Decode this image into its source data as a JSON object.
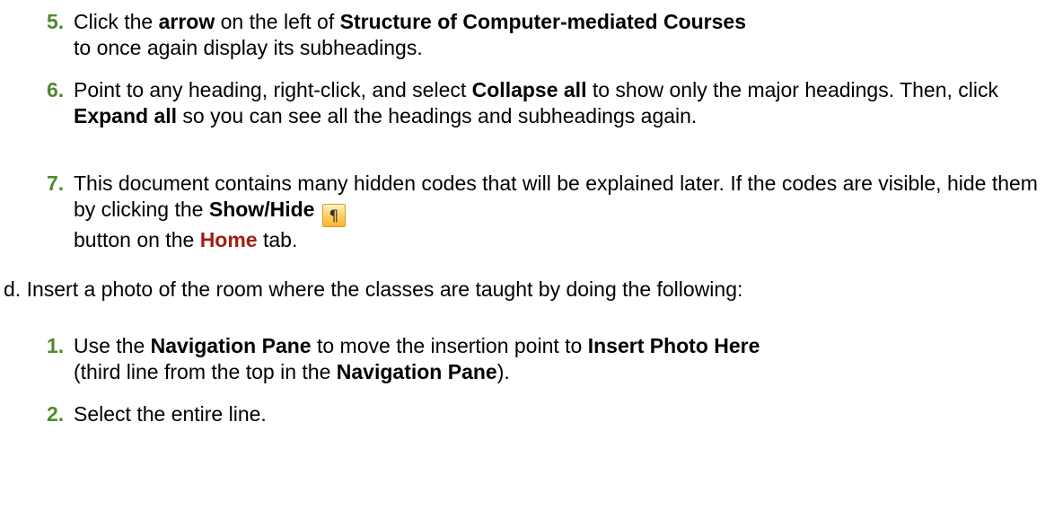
{
  "steps_c": [
    {
      "num": "5.",
      "parts": [
        "Click the ",
        "arrow",
        " on the left of ",
        "Structure of Computer-mediated Courses",
        " to once again display its subheadings."
      ]
    },
    {
      "num": "6.",
      "parts": [
        "Point to any heading, right-click, and select ",
        "Collapse all",
        " to show only the major headings. Then, click ",
        "Expand all",
        " so you can see all the headings and subheadings again."
      ]
    },
    {
      "num": "7.",
      "parts": [
        "This document contains many hidden codes that will be explained later. If the codes are visible, hide them by clicking the ",
        "Show/Hide",
        " button on the ",
        "Home",
        " tab."
      ],
      "icon": "pilcrow-icon",
      "icon_glyph": "¶"
    }
  ],
  "sub_d": "d. Insert a photo of the room where the classes are taught by doing the following:",
  "steps_d": [
    {
      "num": "1.",
      "parts": [
        "Use the ",
        "Navigation Pane",
        " to move the insertion point to ",
        "Insert Photo Here",
        " (third line from the top in the ",
        "Navigation Pane",
        ")."
      ]
    },
    {
      "num": "2.",
      "parts": [
        "Select the entire line."
      ]
    }
  ],
  "colors": {
    "step_number": "#4e8a2e",
    "home_tab": "#a11f12",
    "button_fill": "#ffc94d"
  }
}
